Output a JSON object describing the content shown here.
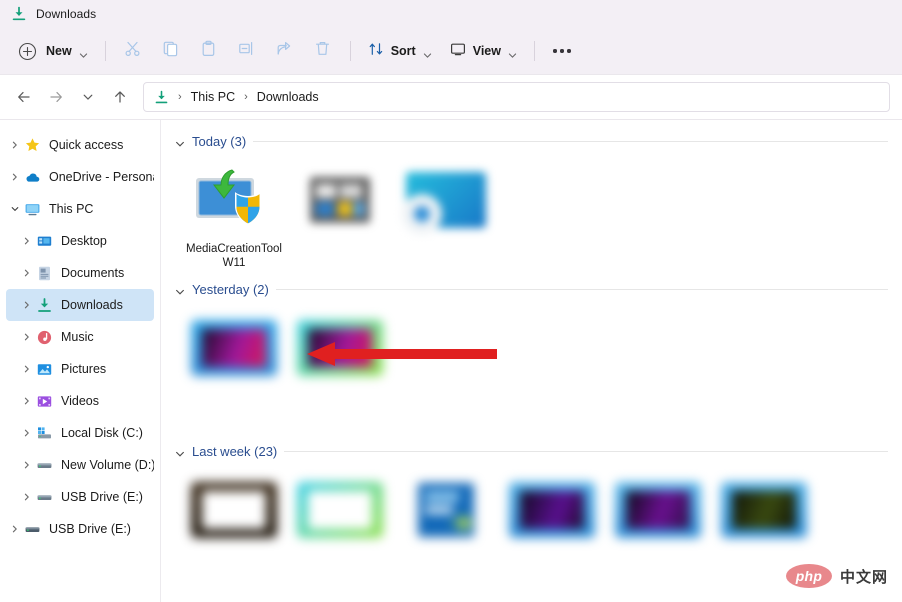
{
  "window": {
    "title": "Downloads",
    "title_icon": "downloads-arrow-icon"
  },
  "toolbar": {
    "new_label": "New",
    "new_icon": "plus-circle-icon",
    "items": [
      {
        "name": "cut",
        "icon": "scissors-icon",
        "label": "",
        "disabled": true
      },
      {
        "name": "copy",
        "icon": "copy-icon",
        "label": "",
        "disabled": true
      },
      {
        "name": "paste",
        "icon": "clipboard-icon",
        "label": "",
        "disabled": true
      },
      {
        "name": "rename",
        "icon": "rename-icon",
        "label": "",
        "disabled": true
      },
      {
        "name": "share",
        "icon": "share-icon",
        "label": "",
        "disabled": true
      },
      {
        "name": "delete",
        "icon": "trash-icon",
        "label": "",
        "disabled": true
      }
    ],
    "sort_label": "Sort",
    "sort_icon": "sort-arrows-icon",
    "view_label": "View",
    "view_icon": "view-monitor-icon",
    "more_label": "See more",
    "more_icon": "ellipsis-icon"
  },
  "addressbar": {
    "back_icon": "arrow-left-icon",
    "forward_icon": "arrow-right-icon",
    "recent_icon": "chevron-down-icon",
    "up_icon": "arrow-up-icon",
    "path_icon": "downloads-arrow-icon",
    "crumbs": [
      "This PC",
      "Downloads"
    ],
    "separator": "›"
  },
  "sidebar": {
    "items": [
      {
        "label": "Quick access",
        "icon": "star-icon",
        "level": 1,
        "expanded": false,
        "selected": false
      },
      {
        "label": "OneDrive - Personal",
        "icon": "cloud-icon",
        "level": 1,
        "expanded": false,
        "selected": false
      },
      {
        "label": "This PC",
        "icon": "monitor-icon",
        "level": 1,
        "expanded": true,
        "selected": false
      },
      {
        "label": "Desktop",
        "icon": "desktop-icon",
        "level": 2,
        "expanded": false,
        "selected": false
      },
      {
        "label": "Documents",
        "icon": "documents-icon",
        "level": 2,
        "expanded": false,
        "selected": false
      },
      {
        "label": "Downloads",
        "icon": "downloads-icon",
        "level": 2,
        "expanded": false,
        "selected": true
      },
      {
        "label": "Music",
        "icon": "music-icon",
        "level": 2,
        "expanded": false,
        "selected": false
      },
      {
        "label": "Pictures",
        "icon": "pictures-icon",
        "level": 2,
        "expanded": false,
        "selected": false
      },
      {
        "label": "Videos",
        "icon": "videos-icon",
        "level": 2,
        "expanded": false,
        "selected": false
      },
      {
        "label": "Local Disk (C:)",
        "icon": "harddisk-icon",
        "level": 2,
        "expanded": false,
        "selected": false
      },
      {
        "label": "New Volume (D:)",
        "icon": "drive-icon",
        "level": 2,
        "expanded": false,
        "selected": false
      },
      {
        "label": "USB Drive (E:)",
        "icon": "drive-icon",
        "level": 2,
        "expanded": false,
        "selected": false
      },
      {
        "label": "USB Drive (E:)",
        "icon": "drive-icon",
        "level": 1,
        "expanded": false,
        "selected": false
      }
    ]
  },
  "content": {
    "groups": [
      {
        "title": "Today (3)",
        "items": [
          {
            "name": "MediaCreationToolW11",
            "thumb": "media-creation-tool-icon",
            "blurred": false
          },
          {
            "name": "",
            "thumb": "blurred-thumbnail",
            "blurred": true
          },
          {
            "name": "",
            "thumb": "blurred-thumbnail",
            "blurred": true
          }
        ]
      },
      {
        "title": "Yesterday (2)",
        "items": [
          {
            "name": "",
            "thumb": "blurred-thumbnail",
            "blurred": true
          },
          {
            "name": "",
            "thumb": "blurred-thumbnail",
            "blurred": true
          }
        ]
      },
      {
        "title": "Last week (23)",
        "items": [
          {
            "name": "",
            "thumb": "blurred-thumbnail",
            "blurred": true
          },
          {
            "name": "",
            "thumb": "blurred-thumbnail",
            "blurred": true
          },
          {
            "name": "",
            "thumb": "blurred-thumbnail",
            "blurred": true
          },
          {
            "name": "",
            "thumb": "blurred-thumbnail",
            "blurred": true
          },
          {
            "name": "",
            "thumb": "blurred-thumbnail",
            "blurred": true
          },
          {
            "name": "",
            "thumb": "blurred-thumbnail",
            "blurred": true
          }
        ]
      }
    ]
  },
  "annotation": {
    "arrow_color": "#e02020",
    "arrow_direction": "left",
    "target": "MediaCreationToolW11"
  },
  "watermark": {
    "brand": "php",
    "suffix": "中文网"
  },
  "colors": {
    "chrome": "#f3eff5",
    "selection": "#cfe4f7",
    "group_header": "#2a4d8f",
    "accent_green": "#18a06a",
    "arrow_red": "#e02020"
  }
}
